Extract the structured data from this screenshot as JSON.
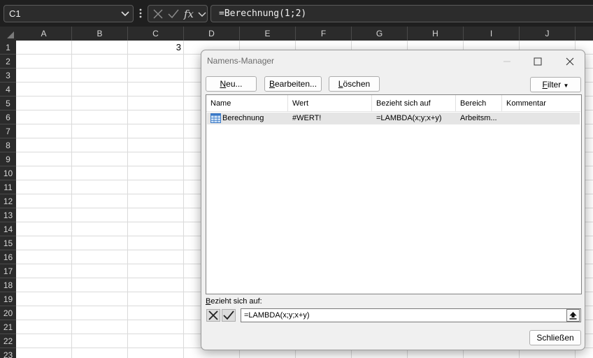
{
  "formula_bar": {
    "name_box": "C1",
    "formula": "=Berechnung(1;2)",
    "icons": [
      "chevron-down-icon",
      "more-vertical-icon",
      "cancel-icon",
      "check-icon",
      "fx-icon",
      "chevron-down-icon"
    ]
  },
  "sheet": {
    "columns": [
      "A",
      "B",
      "C",
      "D",
      "E",
      "F",
      "G",
      "H",
      "I",
      "J"
    ],
    "rows": [
      "1",
      "2",
      "3",
      "4",
      "5",
      "6",
      "7",
      "8",
      "9",
      "10",
      "11",
      "12",
      "13",
      "14",
      "15",
      "16",
      "17",
      "18",
      "19",
      "20",
      "21",
      "22",
      "23"
    ],
    "cell_c1": "3"
  },
  "dialog": {
    "title": "Namens-Manager",
    "buttons": {
      "new": {
        "pre": "",
        "key": "N",
        "post": "eu..."
      },
      "edit": {
        "pre": "",
        "key": "B",
        "post": "earbeiten..."
      },
      "delete": {
        "pre": "",
        "key": "L",
        "post": "öschen"
      },
      "filter": {
        "pre": "",
        "key": "F",
        "post": "ilter"
      },
      "close": "Schließen"
    },
    "list_headers": [
      "Name",
      "Wert",
      "Bezieht sich auf",
      "Bereich",
      "Kommentar"
    ],
    "rows": [
      {
        "name": "Berechnung",
        "value": "#WERT!",
        "refers_to": "=LAMBDA(x;y;x+y)",
        "scope": "Arbeitsm...",
        "comment": ""
      }
    ],
    "refers_label": {
      "key": "B",
      "rest": "ezieht sich auf:"
    },
    "refers_value": "=LAMBDA(x;y;x+y)"
  },
  "colors": {
    "chrome_dark": "#1f1f1f",
    "header_dark": "#2b2b2b",
    "gridline": "#dadada",
    "dialog_bg": "#f0f0f0",
    "selected_row": "#e5e5e5"
  }
}
